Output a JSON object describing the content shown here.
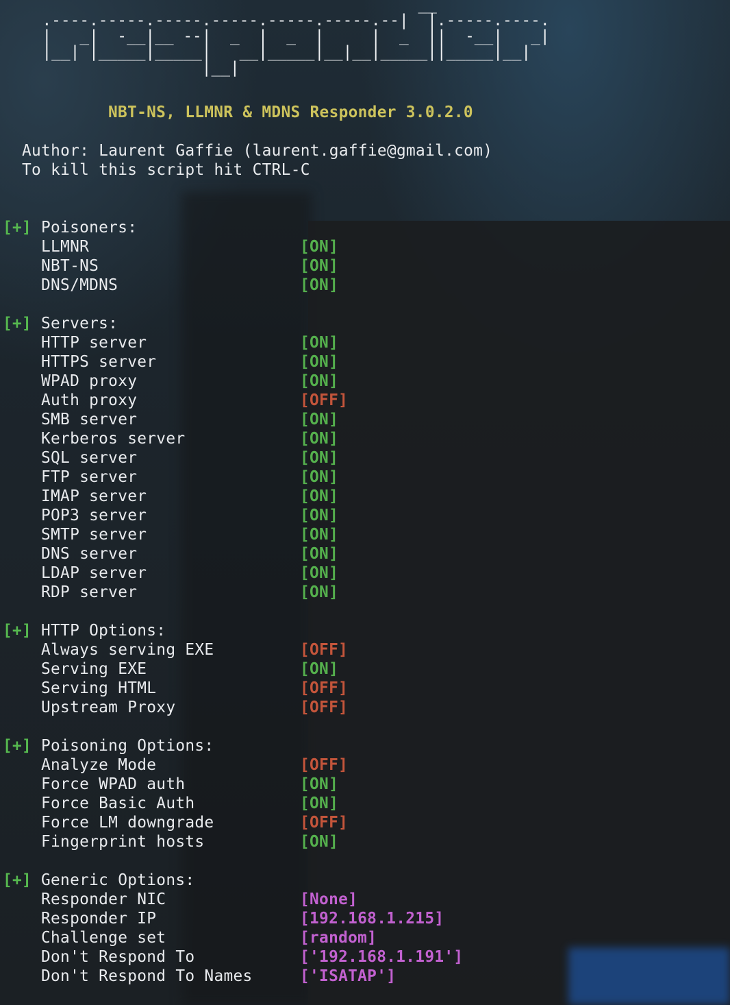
{
  "banner": {
    "art": "                                          __\n  .----.-----.-----.-----.-----.-----.--|  |.-----.----.\n  |   _|  -__|__ --|  _  |  _  |     |  _  ||  -__|   _|\n  |__| |_____|_____|   __|_____|__|__|_____||_____|__|\n                   |__|"
  },
  "header": {
    "title": "NBT-NS, LLMNR & MDNS Responder 3.0.2.0",
    "author": "Author: Laurent Gaffie (laurent.gaffie@gmail.com)",
    "kill_hint": "To kill this script hit CTRL-C"
  },
  "marker": "[+]",
  "sections": [
    {
      "heading": "Poisoners:",
      "items": [
        {
          "label": "LLMNR",
          "value": "[ON]",
          "kind": "on"
        },
        {
          "label": "NBT-NS",
          "value": "[ON]",
          "kind": "on"
        },
        {
          "label": "DNS/MDNS",
          "value": "[ON]",
          "kind": "on"
        }
      ]
    },
    {
      "heading": "Servers:",
      "items": [
        {
          "label": "HTTP server",
          "value": "[ON]",
          "kind": "on"
        },
        {
          "label": "HTTPS server",
          "value": "[ON]",
          "kind": "on"
        },
        {
          "label": "WPAD proxy",
          "value": "[ON]",
          "kind": "on"
        },
        {
          "label": "Auth proxy",
          "value": "[OFF]",
          "kind": "off"
        },
        {
          "label": "SMB server",
          "value": "[ON]",
          "kind": "on"
        },
        {
          "label": "Kerberos server",
          "value": "[ON]",
          "kind": "on"
        },
        {
          "label": "SQL server",
          "value": "[ON]",
          "kind": "on"
        },
        {
          "label": "FTP server",
          "value": "[ON]",
          "kind": "on"
        },
        {
          "label": "IMAP server",
          "value": "[ON]",
          "kind": "on"
        },
        {
          "label": "POP3 server",
          "value": "[ON]",
          "kind": "on"
        },
        {
          "label": "SMTP server",
          "value": "[ON]",
          "kind": "on"
        },
        {
          "label": "DNS server",
          "value": "[ON]",
          "kind": "on"
        },
        {
          "label": "LDAP server",
          "value": "[ON]",
          "kind": "on"
        },
        {
          "label": "RDP server",
          "value": "[ON]",
          "kind": "on"
        }
      ]
    },
    {
      "heading": "HTTP Options:",
      "items": [
        {
          "label": "Always serving EXE",
          "value": "[OFF]",
          "kind": "off"
        },
        {
          "label": "Serving EXE",
          "value": "[ON]",
          "kind": "on"
        },
        {
          "label": "Serving HTML",
          "value": "[OFF]",
          "kind": "off"
        },
        {
          "label": "Upstream Proxy",
          "value": "[OFF]",
          "kind": "off"
        }
      ]
    },
    {
      "heading": "Poisoning Options:",
      "items": [
        {
          "label": "Analyze Mode",
          "value": "[OFF]",
          "kind": "off"
        },
        {
          "label": "Force WPAD auth",
          "value": "[ON]",
          "kind": "on"
        },
        {
          "label": "Force Basic Auth",
          "value": "[ON]",
          "kind": "on"
        },
        {
          "label": "Force LM downgrade",
          "value": "[OFF]",
          "kind": "off"
        },
        {
          "label": "Fingerprint hosts",
          "value": "[ON]",
          "kind": "on"
        }
      ]
    },
    {
      "heading": "Generic Options:",
      "items": [
        {
          "label": "Responder NIC",
          "value": "[None]",
          "kind": "val"
        },
        {
          "label": "Responder IP",
          "value": "[192.168.1.215]",
          "kind": "val"
        },
        {
          "label": "Challenge set",
          "value": "[random]",
          "kind": "val"
        },
        {
          "label": "Don't Respond To",
          "value": "['192.168.1.191']",
          "kind": "val"
        },
        {
          "label": "Don't Respond To Names",
          "value": "['ISATAP']",
          "kind": "val"
        }
      ]
    }
  ],
  "colors": {
    "on": "#55b04d",
    "off": "#c4553b",
    "value": "#c261d0",
    "title": "#cdc35c",
    "marker": "#56b84f"
  }
}
